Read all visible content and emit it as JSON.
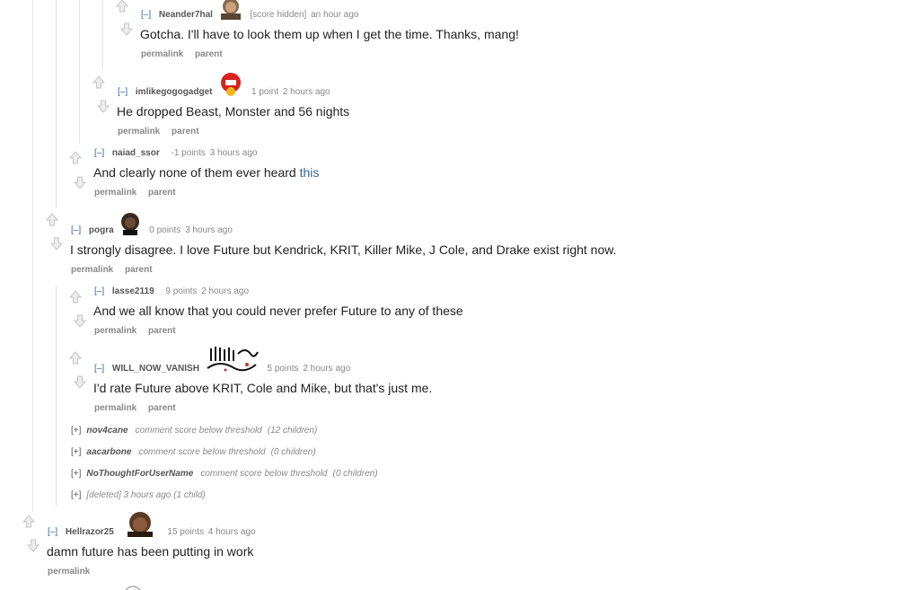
{
  "comments": [
    {
      "toggle": "[–]",
      "author": "Neander7hal",
      "score": "[score hidden]",
      "time": "an hour ago",
      "body": "Gotcha. I'll have to look them up when I get the time. Thanks, mang!",
      "permalink": "permalink",
      "parent": "parent"
    },
    {
      "toggle": "[–]",
      "author": "imlikegogogadget",
      "score": "1 point",
      "time": "2 hours ago",
      "body": "He dropped Beast, Monster and 56 nights",
      "permalink": "permalink",
      "parent": "parent"
    },
    {
      "toggle": "[–]",
      "author": "naiad_ssor",
      "score": "-1 points",
      "time": "3 hours ago",
      "body": "And clearly none of them ever heard ",
      "link": "this",
      "permalink": "permalink",
      "parent": "parent"
    },
    {
      "toggle": "[–]",
      "author": "pogra",
      "score": "0 points",
      "time": "3 hours ago",
      "body": "I strongly disagree. I love Future but Kendrick, KRIT, Killer Mike, J Cole, and Drake exist right now.",
      "permalink": "permalink",
      "parent": "parent"
    },
    {
      "toggle": "[–]",
      "author": "lasse2119",
      "score": "9 points",
      "time": "2 hours ago",
      "body": "And we all know that you could never prefer Future to any of these",
      "permalink": "permalink",
      "parent": "parent"
    },
    {
      "toggle": "[–]",
      "author": "WILL_NOW_VANISH",
      "score": "5 points",
      "time": "2 hours ago",
      "body": "I'd rate Future above KRIT, Cole and Mike, but that's just me.",
      "permalink": "permalink",
      "parent": "parent"
    },
    {
      "toggle": "[–]",
      "author": "Hellrazor25",
      "score": "15 points",
      "time": "4 hours ago",
      "body": "damn future has been putting in work",
      "permalink": "permalink"
    }
  ],
  "collapsed": [
    {
      "toggle": "[+]",
      "author": "nov4cane",
      "note": "comment score below threshold",
      "children": "(12 children)"
    },
    {
      "toggle": "[+]",
      "author": "aacarbone",
      "note": "comment score below threshold",
      "children": "(0 children)"
    },
    {
      "toggle": "[+]",
      "author": "NoThoughtForUserName",
      "note": "comment score below threshold",
      "children": "(0 children)"
    },
    {
      "toggle": "[+]",
      "text": "[deleted] 3 hours ago (1 child)"
    }
  ],
  "colors": {
    "link": "#336699",
    "meta": "#888888",
    "author": "#555555",
    "thread_line": "#e4e4e4"
  }
}
